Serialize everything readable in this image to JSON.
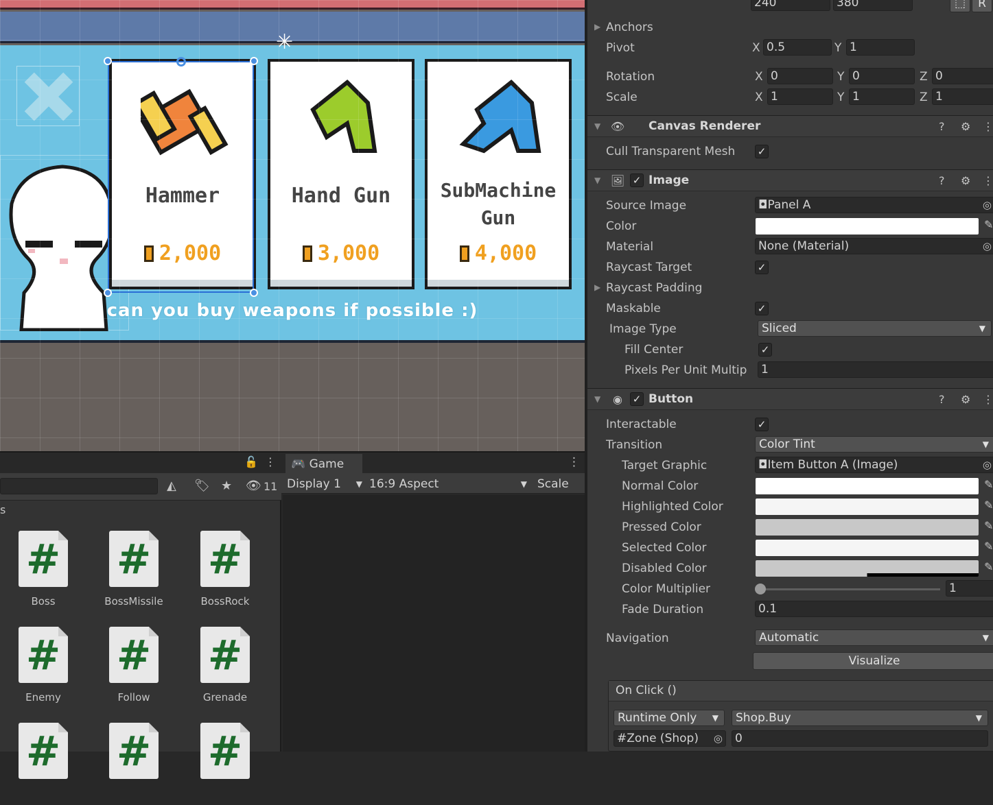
{
  "scene": {
    "items": [
      {
        "name": "Hammer",
        "price": "2,000",
        "color": "#f0843c"
      },
      {
        "name": "Hand Gun",
        "price": "3,000",
        "color": "#9ccc2c"
      },
      {
        "name": "SubMachine Gun",
        "price": "4,000",
        "color": "#3a9ae0"
      }
    ],
    "subtitle": "can you buy weapons if possible :)"
  },
  "project": {
    "hidden_count": "11",
    "breadcrumb": "s",
    "assets": [
      "Boss",
      "BossMissile",
      "BossRock",
      "Enemy",
      "Follow",
      "Grenade"
    ]
  },
  "game": {
    "tab": "Game",
    "display": "Display 1",
    "aspect": "16:9 Aspect",
    "scale": "Scale"
  },
  "inspector": {
    "size_w": "240",
    "size_h": "380",
    "size_btn": "R",
    "anchors": "Anchors",
    "pivot": {
      "label": "Pivot",
      "x": "0.5",
      "y": "1"
    },
    "rotation": {
      "label": "Rotation",
      "x": "0",
      "y": "0",
      "z": "0"
    },
    "scale": {
      "label": "Scale",
      "x": "1",
      "y": "1",
      "z": "1"
    },
    "axes": {
      "x": "X",
      "y": "Y",
      "z": "Z"
    },
    "canvas_renderer": {
      "title": "Canvas Renderer",
      "cull": "Cull Transparent Mesh"
    },
    "image": {
      "title": "Image",
      "source_image_label": "Source Image",
      "source_image": "Panel A",
      "color_label": "Color",
      "material_label": "Material",
      "material": "None (Material)",
      "raycast_target": "Raycast Target",
      "raycast_padding": "Raycast Padding",
      "maskable": "Maskable",
      "image_type_label": "Image Type",
      "image_type": "Sliced",
      "fill_center": "Fill Center",
      "ppu_label": "Pixels Per Unit Multip",
      "ppu": "1"
    },
    "button": {
      "title": "Button",
      "interactable": "Interactable",
      "transition_label": "Transition",
      "transition": "Color Tint",
      "target_graphic_label": "Target Graphic",
      "target_graphic": "Item Button A (Image)",
      "normal_color": "Normal Color",
      "highlighted_color": "Highlighted Color",
      "pressed_color": "Pressed Color",
      "selected_color": "Selected Color",
      "disabled_color": "Disabled Color",
      "color_multiplier_label": "Color Multiplier",
      "color_multiplier": "1",
      "fade_duration_label": "Fade Duration",
      "fade_duration": "0.1",
      "navigation_label": "Navigation",
      "navigation": "Automatic",
      "visualize": "Visualize",
      "on_click": "On Click ()",
      "runtime": "Runtime Only",
      "function": "Shop.Buy",
      "object": "Zone (Shop)",
      "argument": "0"
    },
    "colors": {
      "normal": "#ffffff",
      "highlighted": "#f5f5f5",
      "pressed": "#c8c8c8",
      "selected": "#f5f5f5",
      "disabled": "#c8c8c8",
      "image": "#ffffff"
    }
  }
}
